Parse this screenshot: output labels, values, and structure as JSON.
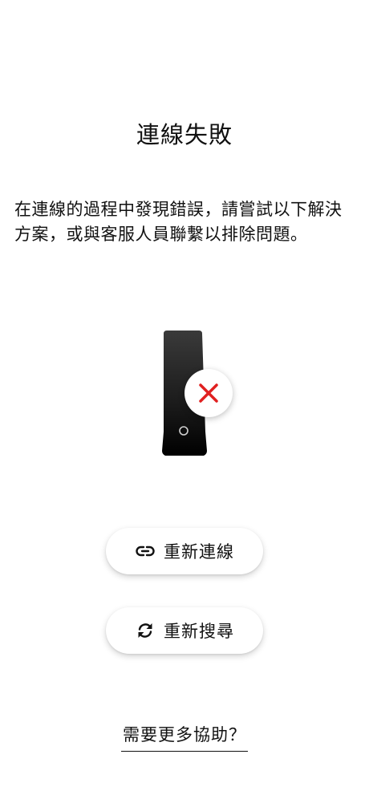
{
  "screen": {
    "title": "連線失敗",
    "message": "在連線的過程中發現錯誤，請嘗試以下解決方案，或與客服人員聯繫以排除問題。"
  },
  "illustration": {
    "device": "router-device",
    "status_icon": "close-icon",
    "status_color": "#e02020"
  },
  "actions": {
    "reconnect": {
      "label": "重新連線",
      "icon": "link-icon"
    },
    "rescan": {
      "label": "重新搜尋",
      "icon": "refresh-icon"
    }
  },
  "help": {
    "label": "需要更多協助？"
  }
}
